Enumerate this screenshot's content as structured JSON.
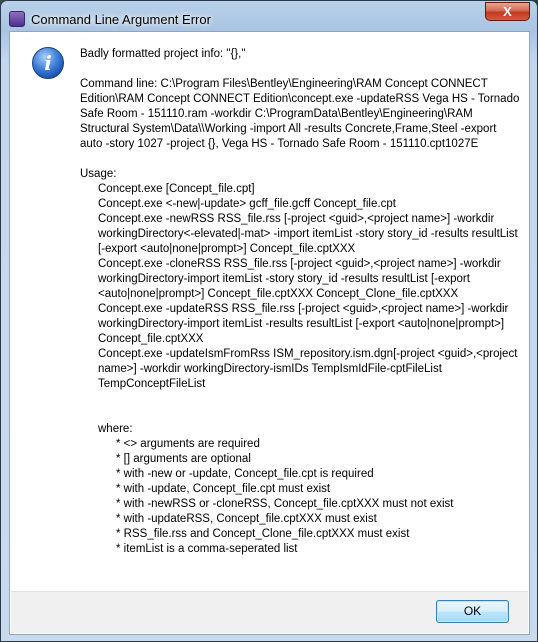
{
  "window": {
    "title": "Command Line Argument Error",
    "close_label": "X"
  },
  "message": {
    "line1": "Badly formatted project info: \"{},\"",
    "command_line": "Command line:  C:\\Program Files\\Bentley\\Engineering\\RAM Concept CONNECT Edition\\RAM Concept CONNECT Edition\\concept.exe -updateRSS Vega HS - Tornado Safe Room - 151110.ram -workdir C:\\ProgramData\\Bentley\\Engineering\\RAM Structural System\\Data\\\\Working -import All -results Concrete,Frame,Steel -export auto -story 1027 -project {}, Vega HS - Tornado Safe Room - 151110.cpt1027E",
    "usage_header": "Usage:",
    "usage_lines": [
      "Concept.exe [Concept_file.cpt]",
      "Concept.exe <-new|-update> gcff_file.gcff Concept_file.cpt",
      "Concept.exe -newRSS RSS_file.rss [-project <guid>,<project name>] -workdir workingDirectory<-elevated|-mat> -import itemList -story story_id -results resultList [-export <auto|none|prompt>] Concept_file.cptXXX",
      "Concept.exe -cloneRSS RSS_file.rss [-project <guid>,<project name>] -workdir workingDirectory-import itemList -story story_id -results resultList [-export <auto|none|prompt>] Concept_file.cptXXX  Concept_Clone_file.cptXXX",
      "Concept.exe -updateRSS RSS_file.rss [-project <guid>,<project name>] -workdir workingDirectory-import itemList -results resultList [-export <auto|none|prompt>] Concept_file.cptXXX",
      "Concept.exe -updateIsmFromRss ISM_repository.ism.dgn[-project <guid>,<project name>] -workdir workingDirectory-ismIDs TempIsmIdFile-cptFileList TempConceptFileList"
    ],
    "where_header": "where:",
    "where_lines": [
      "* <> arguments are required",
      "* [] arguments are optional",
      "* with -new or -update, Concept_file.cpt is required",
      "* with -update, Concept_file.cpt must exist",
      "* with -newRSS or -cloneRSS, Concept_file.cptXXX must not exist",
      "* with -updateRSS, Concept_file.cptXXX must exist",
      "* RSS_file.rss and Concept_Clone_file.cptXXX must exist",
      "* itemList is a comma-seperated list"
    ]
  },
  "buttons": {
    "ok_label": "OK"
  }
}
